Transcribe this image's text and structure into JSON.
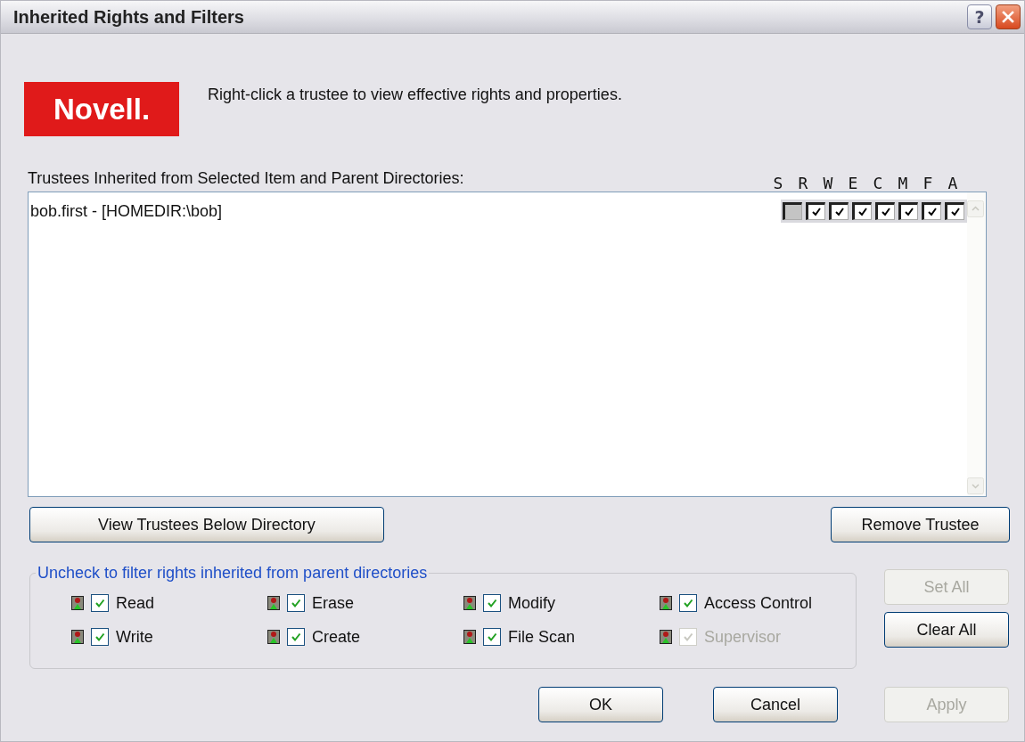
{
  "window": {
    "title": "Inherited Rights and Filters"
  },
  "title_buttons": [
    {
      "kind": "help",
      "label": "?"
    },
    {
      "kind": "close"
    }
  ],
  "logo": {
    "text": "Novell."
  },
  "hint": "Right-click a trustee to view effective rights and properties.",
  "trustees": {
    "label": "Trustees Inherited from Selected Item and Parent Directories:",
    "rights_columns": [
      "S",
      "R",
      "W",
      "E",
      "C",
      "M",
      "F",
      "A"
    ],
    "rows": [
      {
        "name": "bob.first - [HOMEDIR:\\bob]",
        "selected": false,
        "rights": [
          {
            "checked": false
          },
          {
            "checked": true
          },
          {
            "checked": true
          },
          {
            "checked": true
          },
          {
            "checked": true
          },
          {
            "checked": true
          },
          {
            "checked": true
          },
          {
            "checked": true
          }
        ]
      }
    ],
    "buttons": [
      {
        "label": "View Trustees Below Directory",
        "disabled": false
      },
      {
        "label": "Remove Trustee",
        "disabled": false
      }
    ]
  },
  "filters": {
    "legend": "Uncheck to filter rights inherited from parent directories",
    "items": [
      {
        "label": "Read",
        "checked": true,
        "disabled": false
      },
      {
        "label": "Write",
        "checked": true,
        "disabled": false
      },
      {
        "label": "Erase",
        "checked": true,
        "disabled": false
      },
      {
        "label": "Create",
        "checked": true,
        "disabled": false
      },
      {
        "label": "Modify",
        "checked": true,
        "disabled": false
      },
      {
        "label": "File Scan",
        "checked": true,
        "disabled": false
      },
      {
        "label": "Access Control",
        "checked": true,
        "disabled": false
      },
      {
        "label": "Supervisor",
        "checked": true,
        "disabled": true
      }
    ]
  },
  "side_buttons": [
    {
      "label": "Set All",
      "disabled": true
    },
    {
      "label": "Clear All",
      "disabled": false
    }
  ],
  "dialog_buttons": [
    {
      "label": "OK",
      "disabled": false
    },
    {
      "label": "Cancel",
      "disabled": false
    },
    {
      "label": "Apply",
      "disabled": true
    }
  ]
}
